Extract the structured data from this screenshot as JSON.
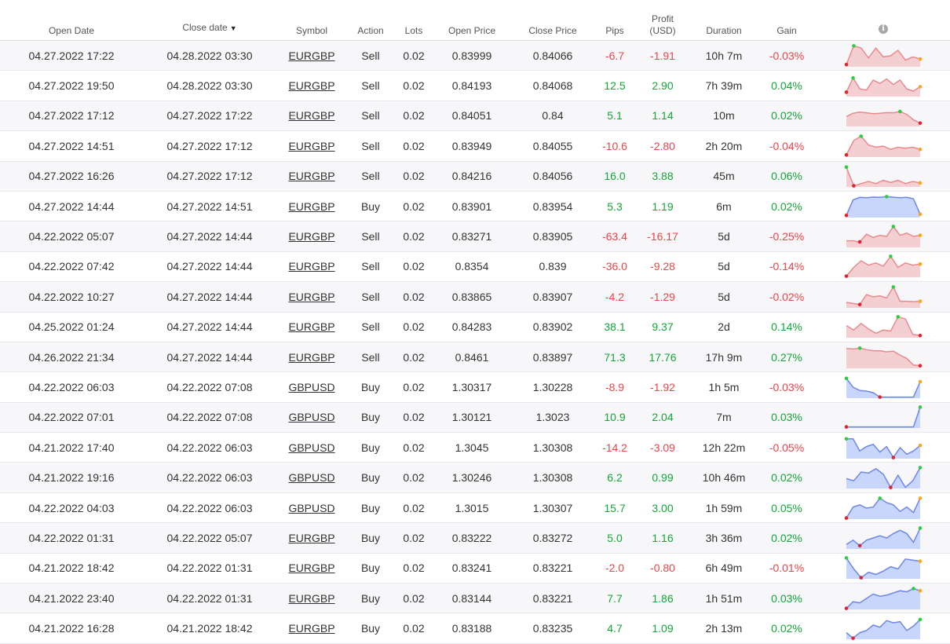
{
  "colors": {
    "positive": "#13a538",
    "negative": "#e8454a",
    "sell_fill": "#f4cfd1",
    "sell_line": "#e88a8e",
    "buy_fill": "#c8d6fb",
    "buy_line": "#6e86e8",
    "marker_high": "#2ecc40",
    "marker_low": "#e0232e",
    "marker_end": "#f5a623"
  },
  "header": {
    "open_date": "Open Date",
    "close_date": "Close date",
    "sort_indicator": "▼",
    "symbol": "Symbol",
    "action": "Action",
    "lots": "Lots",
    "open_price": "Open Price",
    "close_price": "Close Price",
    "pips": "Pips",
    "profit_line1": "Profit",
    "profit_line2": "(USD)",
    "duration": "Duration",
    "gain": "Gain",
    "info_icon": "info-icon"
  },
  "rows": [
    {
      "open_date": "04.27.2022 17:22",
      "close_date": "04.28.2022 03:30",
      "symbol": "EURGBP",
      "action": "Sell",
      "lots": "0.02",
      "open_price": "0.83999",
      "close_price": "0.84066",
      "pips": "-6.7",
      "profit": "-1.91",
      "duration": "10h 7m",
      "gain": "-0.03%",
      "spark": [
        0.1,
        0.95,
        0.85,
        0.4,
        0.85,
        0.45,
        0.5,
        0.75,
        0.3,
        0.45,
        0.35
      ]
    },
    {
      "open_date": "04.27.2022 19:50",
      "close_date": "04.28.2022 03:30",
      "symbol": "EURGBP",
      "action": "Sell",
      "lots": "0.02",
      "open_price": "0.84193",
      "close_price": "0.84068",
      "pips": "12.5",
      "profit": "2.90",
      "duration": "7h 39m",
      "gain": "0.04%",
      "spark": [
        0.2,
        0.85,
        0.35,
        0.3,
        0.75,
        0.6,
        0.8,
        0.55,
        0.75,
        0.35,
        0.25,
        0.45
      ]
    },
    {
      "open_date": "04.27.2022 17:12",
      "close_date": "04.27.2022 17:22",
      "symbol": "EURGBP",
      "action": "Sell",
      "lots": "0.02",
      "open_price": "0.84051",
      "close_price": "0.84",
      "pips": "5.1",
      "profit": "1.14",
      "duration": "10m",
      "gain": "0.02%",
      "spark": [
        0.45,
        0.6,
        0.65,
        0.62,
        0.58,
        0.6,
        0.63,
        0.62,
        0.68,
        0.55,
        0.3,
        0.15
      ]
    },
    {
      "open_date": "04.27.2022 14:51",
      "close_date": "04.27.2022 17:12",
      "symbol": "EURGBP",
      "action": "Sell",
      "lots": "0.02",
      "open_price": "0.83949",
      "close_price": "0.84055",
      "pips": "-10.6",
      "profit": "-2.80",
      "duration": "2h 20m",
      "gain": "-0.04%",
      "spark": [
        0.1,
        0.75,
        0.95,
        0.55,
        0.45,
        0.5,
        0.35,
        0.45,
        0.4,
        0.45,
        0.35
      ]
    },
    {
      "open_date": "04.27.2022 16:26",
      "close_date": "04.27.2022 17:12",
      "symbol": "EURGBP",
      "action": "Sell",
      "lots": "0.02",
      "open_price": "0.84216",
      "close_price": "0.84056",
      "pips": "16.0",
      "profit": "3.88",
      "duration": "45m",
      "gain": "0.06%",
      "spark": [
        0.9,
        0.05,
        0.15,
        0.25,
        0.15,
        0.3,
        0.2,
        0.3,
        0.15,
        0.25,
        0.18
      ]
    },
    {
      "open_date": "04.27.2022 14:44",
      "close_date": "04.27.2022 14:51",
      "symbol": "EURGBP",
      "action": "Buy",
      "lots": "0.02",
      "open_price": "0.83901",
      "close_price": "0.83954",
      "pips": "5.3",
      "profit": "1.19",
      "duration": "6m",
      "gain": "0.02%",
      "spark": [
        0.1,
        0.8,
        0.92,
        0.9,
        0.93,
        0.92,
        0.95,
        0.93,
        0.9,
        0.92,
        0.85,
        0.15
      ]
    },
    {
      "open_date": "04.22.2022 05:07",
      "close_date": "04.27.2022 14:44",
      "symbol": "EURGBP",
      "action": "Sell",
      "lots": "0.02",
      "open_price": "0.83271",
      "close_price": "0.83905",
      "pips": "-63.4",
      "profit": "-16.17",
      "duration": "5d",
      "gain": "-0.25%",
      "spark": [
        0.3,
        0.3,
        0.25,
        0.6,
        0.45,
        0.55,
        0.5,
        0.95,
        0.55,
        0.65,
        0.5,
        0.55
      ]
    },
    {
      "open_date": "04.22.2022 07:42",
      "close_date": "04.27.2022 14:44",
      "symbol": "EURGBP",
      "action": "Sell",
      "lots": "0.02",
      "open_price": "0.8354",
      "close_price": "0.839",
      "pips": "-36.0",
      "profit": "-9.28",
      "duration": "5d",
      "gain": "-0.14%",
      "spark": [
        0.05,
        0.45,
        0.75,
        0.55,
        0.65,
        0.5,
        0.95,
        0.45,
        0.65,
        0.55,
        0.6
      ]
    },
    {
      "open_date": "04.22.2022 10:27",
      "close_date": "04.27.2022 14:44",
      "symbol": "EURGBP",
      "action": "Sell",
      "lots": "0.02",
      "open_price": "0.83865",
      "close_price": "0.83907",
      "pips": "-4.2",
      "profit": "-1.29",
      "duration": "5d",
      "gain": "-0.02%",
      "spark": [
        0.25,
        0.2,
        0.15,
        0.6,
        0.5,
        0.55,
        0.45,
        0.95,
        0.3,
        0.3,
        0.28,
        0.3
      ]
    },
    {
      "open_date": "04.25.2022 01:24",
      "close_date": "04.27.2022 14:44",
      "symbol": "EURGBP",
      "action": "Sell",
      "lots": "0.02",
      "open_price": "0.84283",
      "close_price": "0.83902",
      "pips": "38.1",
      "profit": "9.37",
      "duration": "2d",
      "gain": "0.14%",
      "spark": [
        0.55,
        0.35,
        0.65,
        0.4,
        0.2,
        0.35,
        0.3,
        0.95,
        0.85,
        0.15,
        0.1
      ]
    },
    {
      "open_date": "04.26.2022 21:34",
      "close_date": "04.27.2022 14:44",
      "symbol": "EURGBP",
      "action": "Sell",
      "lots": "0.02",
      "open_price": "0.8461",
      "close_price": "0.83897",
      "pips": "71.3",
      "profit": "17.76",
      "duration": "17h 9m",
      "gain": "0.27%",
      "spark": [
        0.9,
        0.88,
        0.92,
        0.85,
        0.8,
        0.8,
        0.75,
        0.78,
        0.6,
        0.45,
        0.15,
        0.12
      ]
    },
    {
      "open_date": "04.22.2022 06:03",
      "close_date": "04.22.2022 07:08",
      "symbol": "GBPUSD",
      "action": "Buy",
      "lots": "0.02",
      "open_price": "1.30317",
      "close_price": "1.30228",
      "pips": "-8.9",
      "profit": "-1.92",
      "duration": "1h 5m",
      "gain": "-0.03%",
      "spark": [
        0.9,
        0.5,
        0.35,
        0.32,
        0.25,
        0.05,
        0.05,
        0.05,
        0.05,
        0.05,
        0.05,
        0.75
      ]
    },
    {
      "open_date": "04.22.2022 07:01",
      "close_date": "04.22.2022 07:08",
      "symbol": "GBPUSD",
      "action": "Buy",
      "lots": "0.02",
      "open_price": "1.30121",
      "close_price": "1.3023",
      "pips": "10.9",
      "profit": "2.04",
      "duration": "7m",
      "gain": "0.03%",
      "spark": [
        0.05,
        0.05,
        0.05,
        0.05,
        0.05,
        0.05,
        0.05,
        0.05,
        0.05,
        0.05,
        0.05,
        0.95
      ]
    },
    {
      "open_date": "04.21.2022 17:40",
      "close_date": "04.22.2022 06:03",
      "symbol": "GBPUSD",
      "action": "Buy",
      "lots": "0.02",
      "open_price": "1.3045",
      "close_price": "1.30308",
      "pips": "-14.2",
      "profit": "-3.09",
      "duration": "12h 22m",
      "gain": "-0.05%",
      "spark": [
        0.9,
        0.9,
        0.35,
        0.55,
        0.65,
        0.3,
        0.55,
        0.05,
        0.5,
        0.2,
        0.35,
        0.6
      ]
    },
    {
      "open_date": "04.21.2022 19:16",
      "close_date": "04.22.2022 06:03",
      "symbol": "GBPUSD",
      "action": "Buy",
      "lots": "0.02",
      "open_price": "1.30246",
      "close_price": "1.30308",
      "pips": "6.2",
      "profit": "0.99",
      "duration": "10h 46m",
      "gain": "0.02%",
      "spark": [
        0.45,
        0.35,
        0.75,
        0.7,
        0.9,
        0.65,
        0.05,
        0.6,
        0.05,
        0.35,
        0.95
      ]
    },
    {
      "open_date": "04.22.2022 04:03",
      "close_date": "04.22.2022 06:03",
      "symbol": "GBPUSD",
      "action": "Buy",
      "lots": "0.02",
      "open_price": "1.3015",
      "close_price": "1.30307",
      "pips": "15.7",
      "profit": "3.00",
      "duration": "1h 59m",
      "gain": "0.05%",
      "spark": [
        0.05,
        0.55,
        0.65,
        0.5,
        0.55,
        0.95,
        0.75,
        0.65,
        0.35,
        0.55,
        0.3,
        0.95
      ]
    },
    {
      "open_date": "04.22.2022 01:31",
      "close_date": "04.22.2022 05:07",
      "symbol": "EURGBP",
      "action": "Buy",
      "lots": "0.02",
      "open_price": "0.83222",
      "close_price": "0.83272",
      "pips": "5.0",
      "profit": "1.16",
      "duration": "3h 36m",
      "gain": "0.02%",
      "spark": [
        0.2,
        0.4,
        0.15,
        0.4,
        0.5,
        0.6,
        0.5,
        0.7,
        0.85,
        0.7,
        0.3,
        0.95
      ]
    },
    {
      "open_date": "04.21.2022 18:42",
      "close_date": "04.22.2022 01:31",
      "symbol": "EURGBP",
      "action": "Buy",
      "lots": "0.02",
      "open_price": "0.83241",
      "close_price": "0.83221",
      "pips": "-2.0",
      "profit": "-0.80",
      "duration": "6h 49m",
      "gain": "-0.01%",
      "spark": [
        0.95,
        0.45,
        0.05,
        0.3,
        0.2,
        0.35,
        0.55,
        0.45,
        0.9,
        0.85,
        0.8
      ]
    },
    {
      "open_date": "04.21.2022 23:40",
      "close_date": "04.22.2022 01:31",
      "symbol": "EURGBP",
      "action": "Buy",
      "lots": "0.02",
      "open_price": "0.83144",
      "close_price": "0.83221",
      "pips": "7.7",
      "profit": "1.86",
      "duration": "1h 51m",
      "gain": "0.03%",
      "spark": [
        0.05,
        0.35,
        0.3,
        0.5,
        0.7,
        0.6,
        0.65,
        0.75,
        0.85,
        0.8,
        0.95,
        0.85
      ]
    },
    {
      "open_date": "04.21.2022 16:28",
      "close_date": "04.21.2022 18:42",
      "symbol": "EURGBP",
      "action": "Buy",
      "lots": "0.02",
      "open_price": "0.83188",
      "close_price": "0.83235",
      "pips": "4.7",
      "profit": "1.09",
      "duration": "2h 13m",
      "gain": "0.02%",
      "spark": [
        0.3,
        0.05,
        0.3,
        0.4,
        0.65,
        0.55,
        0.85,
        0.75,
        0.8,
        0.4,
        0.6,
        0.9
      ]
    }
  ]
}
